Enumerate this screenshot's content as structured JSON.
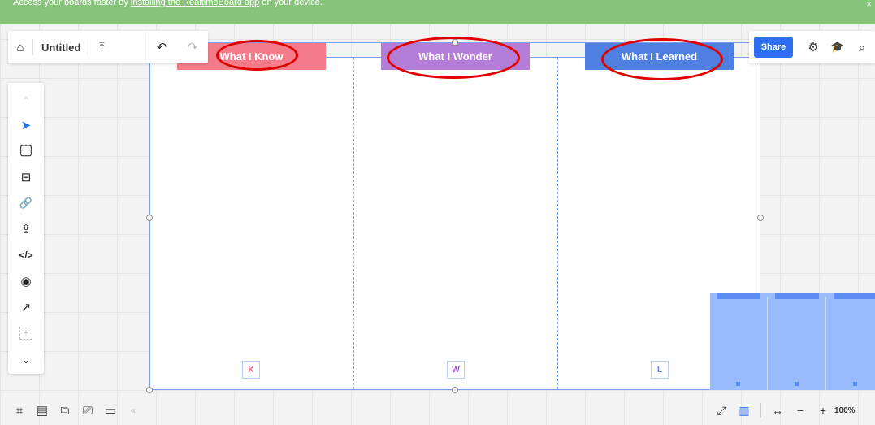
{
  "banner": {
    "text_before": "Access your boards faster by ",
    "link_text": "installing the RealtimeBoard app",
    "text_after": " on your device.",
    "close_glyph": "×"
  },
  "topbar": {
    "home_icon": "⌂",
    "title": "Untitled",
    "export_icon": "⤒",
    "undo_icon": "↶",
    "redo_icon": "↷"
  },
  "right_bar": {
    "share_label": "Share",
    "settings_icon": "⚙",
    "learn_icon": "🎓",
    "search_icon": "⌕"
  },
  "board": {
    "columns": [
      {
        "header": "What I Know",
        "letter": "K",
        "color": "#f47c8a",
        "letter_color": "#f25c74"
      },
      {
        "header": "What I Wonder",
        "letter": "W",
        "color": "#b47ed8",
        "letter_color": "#a557d6"
      },
      {
        "header": "What I Learned",
        "letter": "L",
        "color": "#4f7fe0",
        "letter_color": "#4f7fe0"
      }
    ]
  },
  "toolbar": {
    "collapse_up": "⌃",
    "select_tool": "➤",
    "sticky_note": "▢",
    "templates": "⊟",
    "link": "🔗",
    "upload": "⇪",
    "embed": "</>",
    "view": "◉",
    "arrow": "↗",
    "add_more": "+",
    "collapse_down": "⌄"
  },
  "bottom_bar": {
    "frames_icon": "⌗",
    "comments_icon": "▤",
    "cards_icon": "⧉",
    "share_screen_icon": "⎚",
    "video_icon": "▭",
    "collapse_icon": "«"
  },
  "zoom": {
    "fullscreen_icon": "⤢",
    "map_icon": "▥",
    "fit_icon": "↔",
    "minus_icon": "−",
    "plus_icon": "+",
    "level": "100%"
  }
}
